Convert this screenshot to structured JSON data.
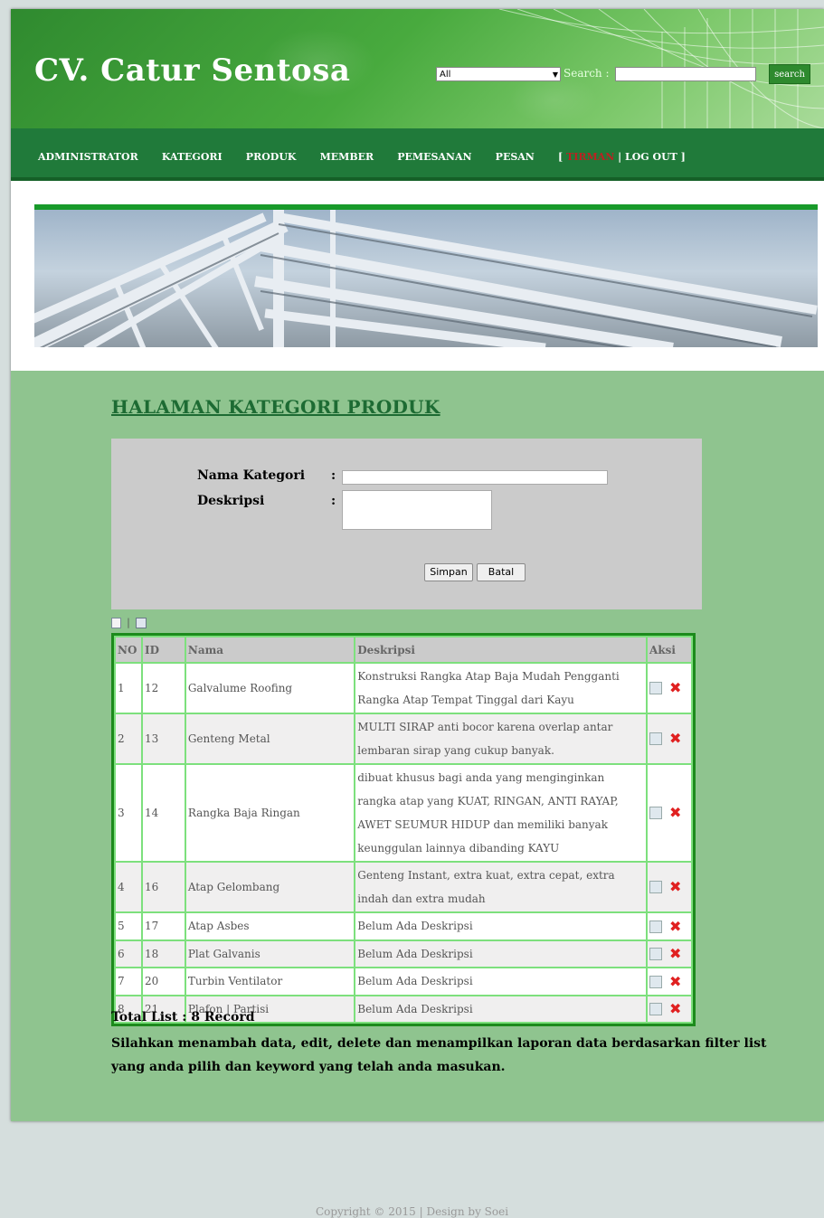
{
  "header": {
    "site_title": "CV. Catur Sentosa",
    "search_select_value": "All",
    "search_label": "Search :",
    "search_input_value": "",
    "search_button": "search"
  },
  "nav": {
    "items": [
      "ADMINISTRATOR",
      "KATEGORI",
      "PRODUK",
      "MEMBER",
      "PEMESANAN",
      "PESAN"
    ],
    "open_bracket": "[",
    "highlight": "TIRMAN",
    "logout": "| LOG OUT ]"
  },
  "page_title": "HALAMAN KATEGORI PRODUK",
  "form": {
    "nama_label": "Nama Kategori",
    "deskripsi_label": "Deskripsi",
    "colon": ":",
    "nama_value": "",
    "deskripsi_value": "",
    "save_button": "Simpan",
    "cancel_button": "Batal"
  },
  "tools_separator": "|",
  "table": {
    "headers": [
      "NO",
      "ID",
      "Nama",
      "Deskripsi",
      "Aksi"
    ],
    "rows": [
      {
        "no": "1",
        "id": "12",
        "nama": "Galvalume Roofing",
        "deskripsi": "Konstruksi Rangka Atap Baja Mudah Pengganti Rangka Atap Tempat Tinggal dari Kayu"
      },
      {
        "no": "2",
        "id": "13",
        "nama": "Genteng Metal",
        "deskripsi": "MULTI SIRAP anti bocor karena overlap antar lembaran sirap yang cukup banyak."
      },
      {
        "no": "3",
        "id": "14",
        "nama": "Rangka Baja Ringan",
        "deskripsi": "dibuat khusus bagi anda yang menginginkan rangka atap yang KUAT, RINGAN, ANTI RAYAP, AWET SEUMUR HIDUP dan memiliki banyak keunggulan lainnya dibanding KAYU"
      },
      {
        "no": "4",
        "id": "16",
        "nama": "Atap Gelombang",
        "deskripsi": "Genteng Instant, extra kuat, extra cepat, extra indah dan extra mudah"
      },
      {
        "no": "5",
        "id": "17",
        "nama": "Atap Asbes",
        "deskripsi": "Belum Ada Deskripsi"
      },
      {
        "no": "6",
        "id": "18",
        "nama": "Plat Galvanis",
        "deskripsi": "Belum Ada Deskripsi"
      },
      {
        "no": "7",
        "id": "20",
        "nama": "Turbin Ventilator",
        "deskripsi": "Belum Ada Deskripsi"
      },
      {
        "no": "8",
        "id": "21",
        "nama": "Plafon | Partisi",
        "deskripsi": "Belum Ada Deskripsi"
      }
    ],
    "delete_glyph": "✖"
  },
  "total": "Total List : 8 Record",
  "info": "Silahkan menambah data, edit, delete dan menampilkan laporan data berdasarkan filter list yang anda pilih dan keyword yang telah anda masukan.",
  "copyright": "Copyright © 2015 | Design by Soei",
  "colors": {
    "header_green": "#3f9f38",
    "nav_green": "#207a3a",
    "content_green": "#8fc48f",
    "table_border": "#1c8a1c",
    "row_border": "#7de07d"
  }
}
